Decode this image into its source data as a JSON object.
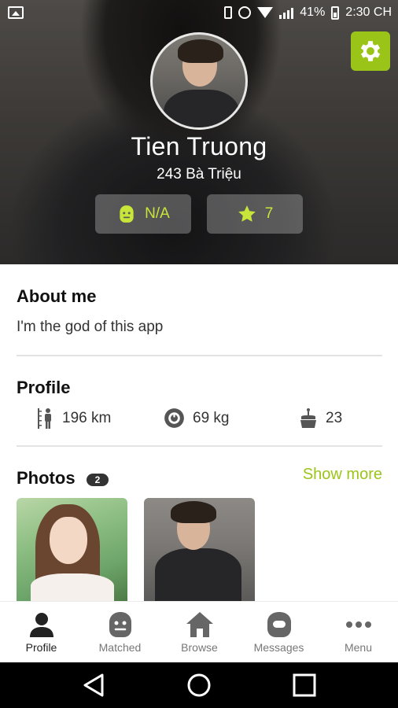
{
  "status_bar": {
    "battery": "41%",
    "time": "2:30 CH"
  },
  "profile": {
    "name": "Tien Truong",
    "address": "243 Bà Triệu",
    "mood_label": "N/A",
    "star_count": "7"
  },
  "about": {
    "title": "About me",
    "text": "I'm the god of this app"
  },
  "profile_section": {
    "title": "Profile",
    "height": "196 km",
    "weight": "69 kg",
    "age": "23"
  },
  "photos": {
    "title": "Photos",
    "count": "2",
    "show_more": "Show more"
  },
  "nav": {
    "items": [
      {
        "label": "Profile",
        "icon": "person-icon",
        "active": true
      },
      {
        "label": "Matched",
        "icon": "matched-face-icon",
        "active": false
      },
      {
        "label": "Browse",
        "icon": "home-icon",
        "active": false
      },
      {
        "label": "Messages",
        "icon": "messages-icon",
        "active": false
      },
      {
        "label": "Menu",
        "icon": "more-dots-icon",
        "active": false
      }
    ]
  },
  "colors": {
    "accent": "#9bc419",
    "stat_text": "#c8e63a"
  }
}
